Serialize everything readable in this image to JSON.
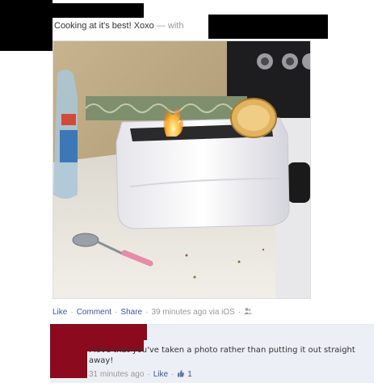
{
  "post": {
    "status_text": "Cooking at it's best! Xoxo",
    "with_text": "— with"
  },
  "actions": {
    "like_label": "Like",
    "comment_label": "Comment",
    "share_label": "Share",
    "timestamp": "39 minutes ago via iOS",
    "audience_icon": "friends-icon"
  },
  "comment": {
    "text": "I love that you've taken a photo rather than putting it out straight away!",
    "timestamp": "31 minutes ago",
    "like_label": "Like",
    "like_count": "1",
    "like_icon": "thumbs-up-icon"
  },
  "colors": {
    "link": "#3b5998",
    "meta": "#999999",
    "comment_bg": "#eceff5",
    "redaction_black": "#000000",
    "redaction_red": "#8b0a1e"
  }
}
